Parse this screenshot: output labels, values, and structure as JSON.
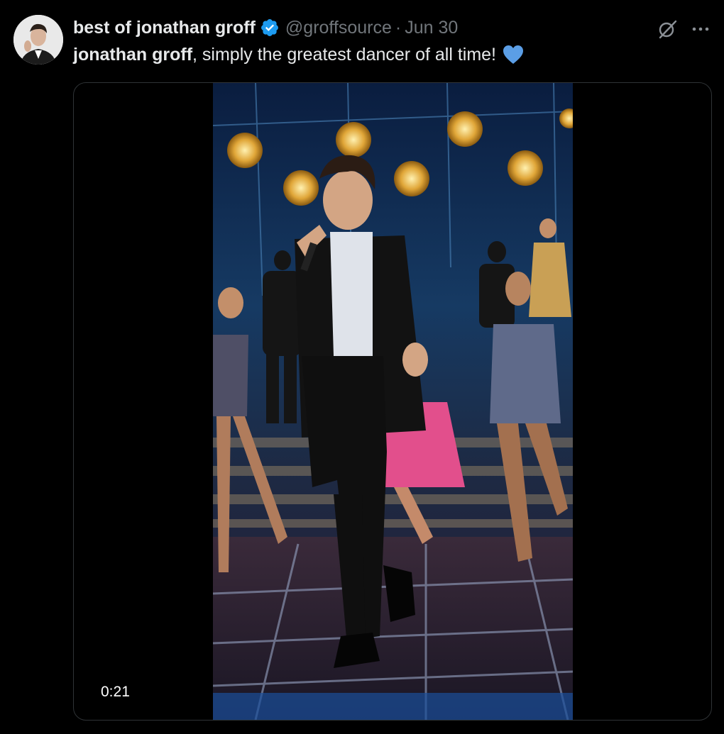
{
  "author": {
    "display_name": "best of jonathan groff",
    "handle": "@groffsource",
    "separator": "·",
    "date": "Jun 30"
  },
  "tweet": {
    "mention": "jonathan groff",
    "text": ", simply the greatest dancer of all time!"
  },
  "media": {
    "duration": "0:21"
  },
  "icons": {
    "verified": "verified-badge-icon",
    "heart": "blue-heart-icon",
    "grok": "grok-icon",
    "more": "more-options-icon"
  },
  "colors": {
    "background": "#000000",
    "text": "#e7e9ea",
    "secondary_text": "#71767b",
    "verified_blue": "#1d9bf0",
    "heart_blue": "#5b9ee6"
  }
}
